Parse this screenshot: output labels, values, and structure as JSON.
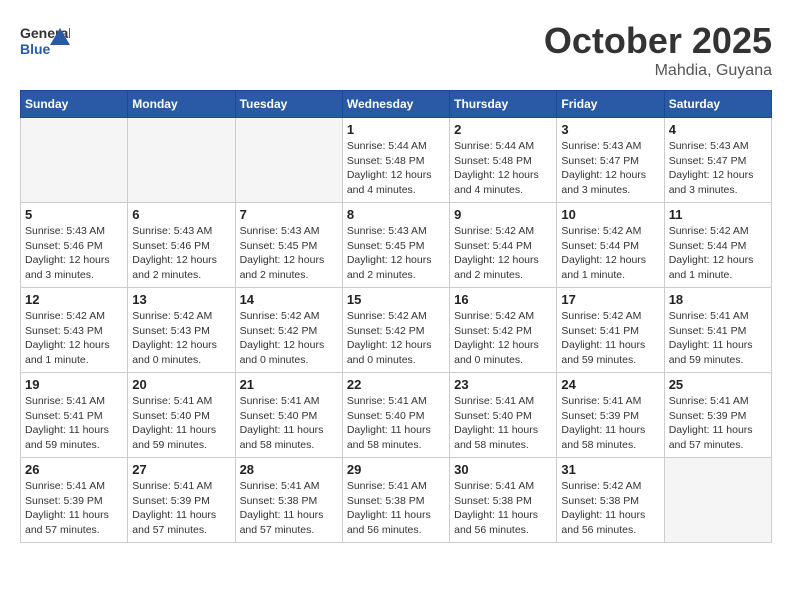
{
  "header": {
    "logo_general": "General",
    "logo_blue": "Blue",
    "month": "October 2025",
    "location": "Mahdia, Guyana"
  },
  "days_of_week": [
    "Sunday",
    "Monday",
    "Tuesday",
    "Wednesday",
    "Thursday",
    "Friday",
    "Saturday"
  ],
  "weeks": [
    [
      {
        "day": "",
        "info": ""
      },
      {
        "day": "",
        "info": ""
      },
      {
        "day": "",
        "info": ""
      },
      {
        "day": "1",
        "info": "Sunrise: 5:44 AM\nSunset: 5:48 PM\nDaylight: 12 hours and 4 minutes."
      },
      {
        "day": "2",
        "info": "Sunrise: 5:44 AM\nSunset: 5:48 PM\nDaylight: 12 hours and 4 minutes."
      },
      {
        "day": "3",
        "info": "Sunrise: 5:43 AM\nSunset: 5:47 PM\nDaylight: 12 hours and 3 minutes."
      },
      {
        "day": "4",
        "info": "Sunrise: 5:43 AM\nSunset: 5:47 PM\nDaylight: 12 hours and 3 minutes."
      }
    ],
    [
      {
        "day": "5",
        "info": "Sunrise: 5:43 AM\nSunset: 5:46 PM\nDaylight: 12 hours and 3 minutes."
      },
      {
        "day": "6",
        "info": "Sunrise: 5:43 AM\nSunset: 5:46 PM\nDaylight: 12 hours and 2 minutes."
      },
      {
        "day": "7",
        "info": "Sunrise: 5:43 AM\nSunset: 5:45 PM\nDaylight: 12 hours and 2 minutes."
      },
      {
        "day": "8",
        "info": "Sunrise: 5:43 AM\nSunset: 5:45 PM\nDaylight: 12 hours and 2 minutes."
      },
      {
        "day": "9",
        "info": "Sunrise: 5:42 AM\nSunset: 5:44 PM\nDaylight: 12 hours and 2 minutes."
      },
      {
        "day": "10",
        "info": "Sunrise: 5:42 AM\nSunset: 5:44 PM\nDaylight: 12 hours and 1 minute."
      },
      {
        "day": "11",
        "info": "Sunrise: 5:42 AM\nSunset: 5:44 PM\nDaylight: 12 hours and 1 minute."
      }
    ],
    [
      {
        "day": "12",
        "info": "Sunrise: 5:42 AM\nSunset: 5:43 PM\nDaylight: 12 hours and 1 minute."
      },
      {
        "day": "13",
        "info": "Sunrise: 5:42 AM\nSunset: 5:43 PM\nDaylight: 12 hours and 0 minutes."
      },
      {
        "day": "14",
        "info": "Sunrise: 5:42 AM\nSunset: 5:42 PM\nDaylight: 12 hours and 0 minutes."
      },
      {
        "day": "15",
        "info": "Sunrise: 5:42 AM\nSunset: 5:42 PM\nDaylight: 12 hours and 0 minutes."
      },
      {
        "day": "16",
        "info": "Sunrise: 5:42 AM\nSunset: 5:42 PM\nDaylight: 12 hours and 0 minutes."
      },
      {
        "day": "17",
        "info": "Sunrise: 5:42 AM\nSunset: 5:41 PM\nDaylight: 11 hours and 59 minutes."
      },
      {
        "day": "18",
        "info": "Sunrise: 5:41 AM\nSunset: 5:41 PM\nDaylight: 11 hours and 59 minutes."
      }
    ],
    [
      {
        "day": "19",
        "info": "Sunrise: 5:41 AM\nSunset: 5:41 PM\nDaylight: 11 hours and 59 minutes."
      },
      {
        "day": "20",
        "info": "Sunrise: 5:41 AM\nSunset: 5:40 PM\nDaylight: 11 hours and 59 minutes."
      },
      {
        "day": "21",
        "info": "Sunrise: 5:41 AM\nSunset: 5:40 PM\nDaylight: 11 hours and 58 minutes."
      },
      {
        "day": "22",
        "info": "Sunrise: 5:41 AM\nSunset: 5:40 PM\nDaylight: 11 hours and 58 minutes."
      },
      {
        "day": "23",
        "info": "Sunrise: 5:41 AM\nSunset: 5:40 PM\nDaylight: 11 hours and 58 minutes."
      },
      {
        "day": "24",
        "info": "Sunrise: 5:41 AM\nSunset: 5:39 PM\nDaylight: 11 hours and 58 minutes."
      },
      {
        "day": "25",
        "info": "Sunrise: 5:41 AM\nSunset: 5:39 PM\nDaylight: 11 hours and 57 minutes."
      }
    ],
    [
      {
        "day": "26",
        "info": "Sunrise: 5:41 AM\nSunset: 5:39 PM\nDaylight: 11 hours and 57 minutes."
      },
      {
        "day": "27",
        "info": "Sunrise: 5:41 AM\nSunset: 5:39 PM\nDaylight: 11 hours and 57 minutes."
      },
      {
        "day": "28",
        "info": "Sunrise: 5:41 AM\nSunset: 5:38 PM\nDaylight: 11 hours and 57 minutes."
      },
      {
        "day": "29",
        "info": "Sunrise: 5:41 AM\nSunset: 5:38 PM\nDaylight: 11 hours and 56 minutes."
      },
      {
        "day": "30",
        "info": "Sunrise: 5:41 AM\nSunset: 5:38 PM\nDaylight: 11 hours and 56 minutes."
      },
      {
        "day": "31",
        "info": "Sunrise: 5:42 AM\nSunset: 5:38 PM\nDaylight: 11 hours and 56 minutes."
      },
      {
        "day": "",
        "info": ""
      }
    ]
  ]
}
